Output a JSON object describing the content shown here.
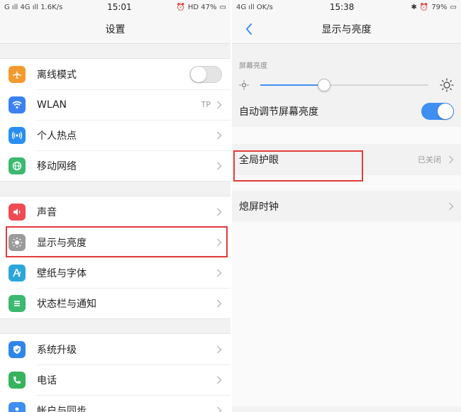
{
  "left": {
    "status": {
      "left": "G ıll 4G ıll 1.6K/s",
      "time": "15:01",
      "right": "HD 47%"
    },
    "title": "设置",
    "groups": [
      {
        "items": [
          {
            "id": "airplane",
            "label": "离线模式",
            "icon": "airplane-icon",
            "color": "#f39a2e",
            "control": "toggle-off"
          },
          {
            "id": "wlan",
            "label": "WLAN",
            "icon": "wifi-icon",
            "color": "#3b82f0",
            "value": "TP",
            "control": "chevron"
          },
          {
            "id": "hotspot",
            "label": "个人热点",
            "icon": "hotspot-icon",
            "color": "#2a8ef0",
            "control": "chevron"
          },
          {
            "id": "mobile",
            "label": "移动网络",
            "icon": "globe-icon",
            "color": "#3cb86f",
            "control": "chevron"
          }
        ]
      },
      {
        "items": [
          {
            "id": "sound",
            "label": "声音",
            "icon": "speaker-icon",
            "color": "#ee4b55",
            "control": "chevron"
          },
          {
            "id": "display",
            "label": "显示与亮度",
            "icon": "brightness-icon",
            "color": "#9b9b9b",
            "control": "chevron"
          },
          {
            "id": "wallpaper",
            "label": "壁纸与字体",
            "icon": "font-icon",
            "color": "#2ca6d9",
            "control": "chevron"
          },
          {
            "id": "statusbar",
            "label": "状态栏与通知",
            "icon": "list-icon",
            "color": "#3cb86f",
            "control": "chevron"
          }
        ]
      },
      {
        "items": [
          {
            "id": "update",
            "label": "系统升级",
            "icon": "shield-icon",
            "color": "#2f86e6",
            "control": "chevron"
          },
          {
            "id": "phone",
            "label": "电话",
            "icon": "phone-icon",
            "color": "#37b35e",
            "control": "chevron"
          },
          {
            "id": "account",
            "label": "帐户与同步",
            "icon": "sync-icon",
            "color": "#3f8ef2",
            "control": "chevron"
          }
        ]
      }
    ]
  },
  "right": {
    "status": {
      "left": "4G ıll OK/s",
      "time": "15:38",
      "right": "79%"
    },
    "title": "显示与亮度",
    "brightness_label": "屏幕亮度",
    "brightness_level": 0.38,
    "auto_label": "自动调节屏幕亮度",
    "eye_label": "全局护眼",
    "eye_value": "已关闭",
    "aod_label": "熄屏时钟"
  },
  "colors": {
    "accent": "#3f8ef2",
    "highlight": "#e23b3b"
  }
}
